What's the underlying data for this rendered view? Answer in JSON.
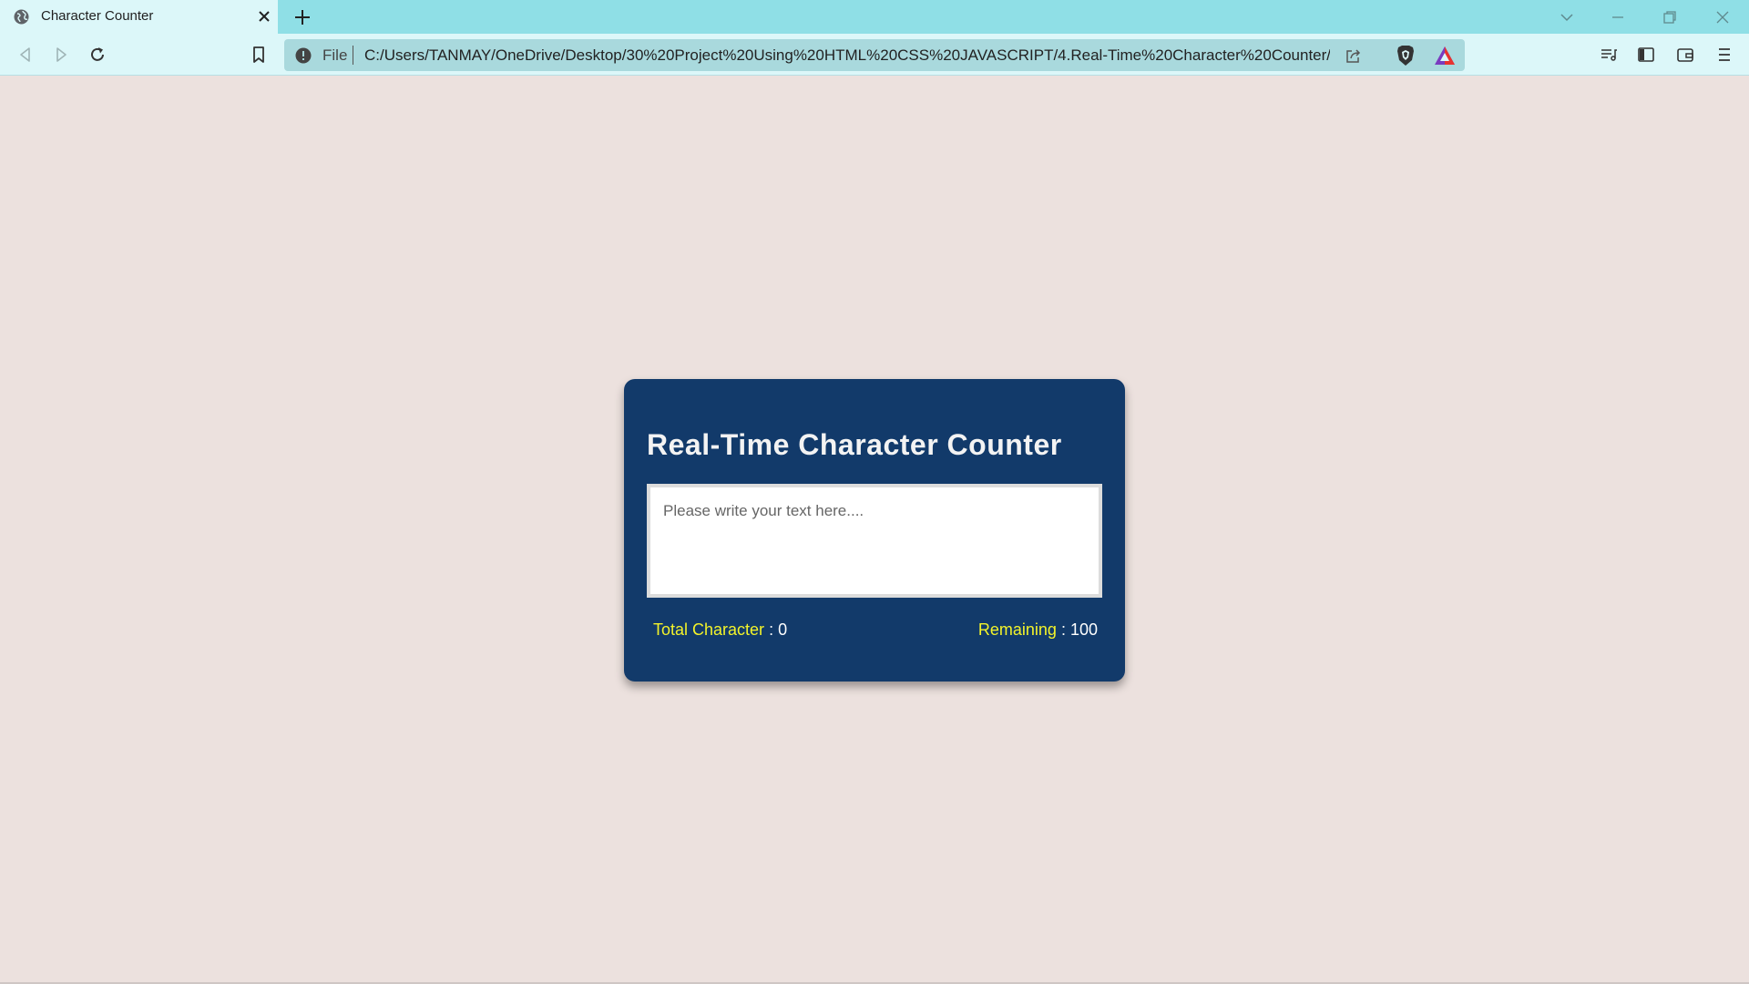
{
  "browser": {
    "tab": {
      "title": "Character Counter",
      "favicon": "globe-icon"
    },
    "address_bar": {
      "scheme_label": "File",
      "url": "C:/Users/TANMAY/OneDrive/Desktop/30%20Project%20Using%20HTML%20CSS%20JAVASCRIPT/4.Real-Time%20Character%20Counter/..."
    },
    "colors": {
      "tabstrip": "#8fdfe6",
      "toolbar": "#dcf7f9",
      "omnibox": "#a9d9dd"
    }
  },
  "page": {
    "background": "#ece1de",
    "card": {
      "background": "#123a6a",
      "title": "Real-Time Character Counter",
      "textarea_placeholder": "Please write your text here....",
      "total_label": "Total Character",
      "total_value": "0",
      "remaining_label": "Remaining",
      "remaining_value": "100",
      "label_color": "#f3f32a"
    }
  }
}
